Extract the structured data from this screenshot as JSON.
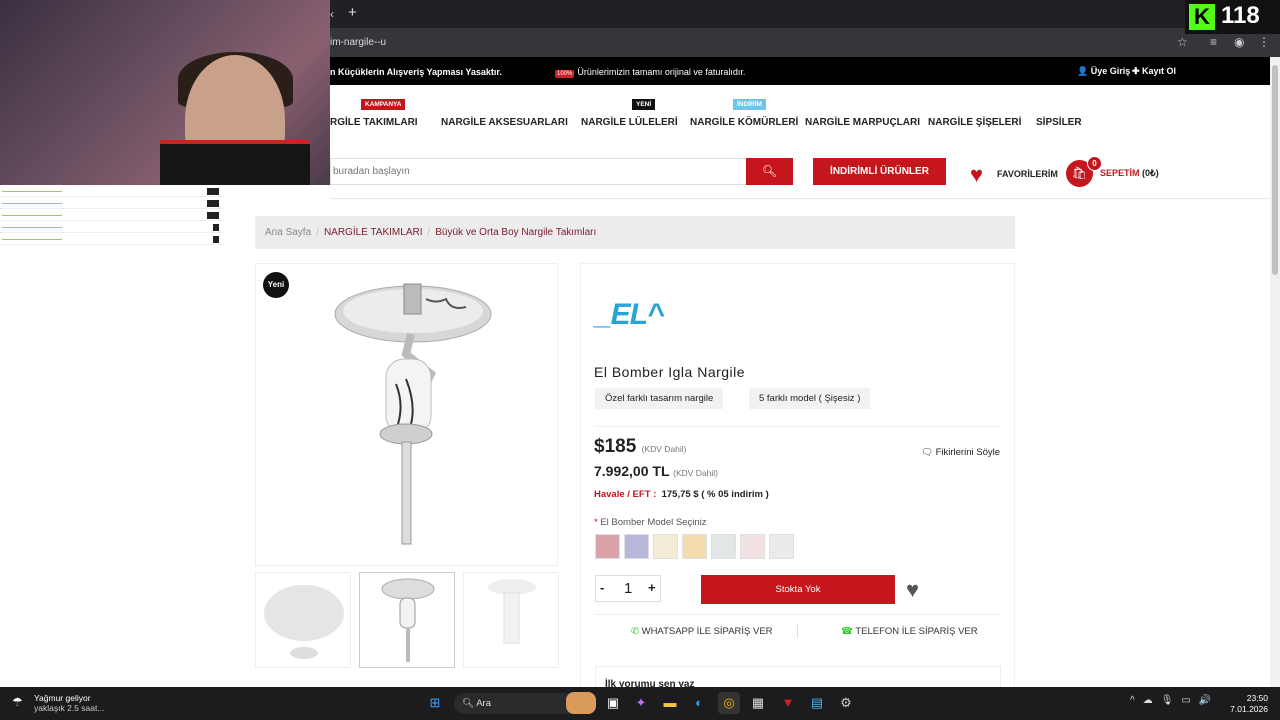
{
  "browser": {
    "url": "im-nargile--u",
    "tab_close": "‹",
    "new_tab": "+"
  },
  "stream": {
    "viewer_count": "118",
    "logo_letter": "K"
  },
  "topbar": {
    "left_text": "n Küçüklerin Alışveriş Yapması Yasaktır.",
    "center_badge": "100%",
    "center_text": "Ürünlerimizin tamamı orijinal ve faturalıdır.",
    "login": "Üye Giriş",
    "register": "Kayıt Ol"
  },
  "nav": {
    "items": [
      {
        "label": "RGİLE TAKIMLARI",
        "badge": "KAMPANYA",
        "badge_color": "#c4161c"
      },
      {
        "label": "NARGİLE AKSESUARLARI",
        "badge": "",
        "badge_color": ""
      },
      {
        "label": "NARGİLE LÜLELERİ",
        "badge": "YENİ",
        "badge_color": "#111111"
      },
      {
        "label": "NARGİLE KÖMÜRLERİ",
        "badge": "İNDİRİM",
        "badge_color": "#6fc4ea"
      },
      {
        "label": "NARGİLE MARPUÇLARI",
        "badge": "",
        "badge_color": ""
      },
      {
        "label": "NARGİLE ŞİŞELERİ",
        "badge": "",
        "badge_color": ""
      },
      {
        "label": "SİPSİLER",
        "badge": "",
        "badge_color": ""
      }
    ]
  },
  "search": {
    "placeholder": "buradan başlayın"
  },
  "header": {
    "discount_button": "İNDİRİMLİ ÜRÜNLER",
    "favorites": "FAVORİLERİM",
    "cart_label": "SEPETİM",
    "cart_total": "(0₺)",
    "cart_count": "0"
  },
  "breadcrumb": {
    "home": "Ana Sayfa",
    "category": "NARGİLE TAKIMLARI",
    "subcategory": "Büyük ve Orta Boy Nargile Takımları"
  },
  "product": {
    "new_badge": "Yeni",
    "brand_logo": "_EL^",
    "title": "El Bomber Igla Nargile",
    "features": [
      "Özel farklı tasarım nargile",
      "5 farklı model ( Şişesiz )"
    ],
    "price_usd": "$185",
    "price_kdv": "(KDV Dahil)",
    "price_try": "7.992,00 TL",
    "havale_label": "Havale / EFT :",
    "havale_value": "175,75 $ ( % 05 indirim )",
    "feedback": "Fikirlerini Söyle",
    "model_label": "El Bomber Model Seçiniz",
    "model_required": "*",
    "swatches": [
      "#d9a3ab",
      "#b9b6dc",
      "#f3ecd6",
      "#f4dcb1",
      "#e3e6e7",
      "#f3e2e4",
      "#eaeaea"
    ],
    "quantity": "1",
    "qty_minus": "-",
    "qty_plus": "+",
    "stock_button": "Stokta Yok",
    "whatsapp": "WHATSAPP İLE SİPARİŞ VER",
    "phone": "TELEFON İLE SİPARİŞ VER",
    "first_review": "İlk yorumu sen yaz"
  },
  "taskbar": {
    "weather_title": "Yağmur geliyor",
    "weather_sub": "yaklaşık 2.5 saat...",
    "search": "Ara",
    "time": "23:50",
    "date": "7.01.2026"
  }
}
